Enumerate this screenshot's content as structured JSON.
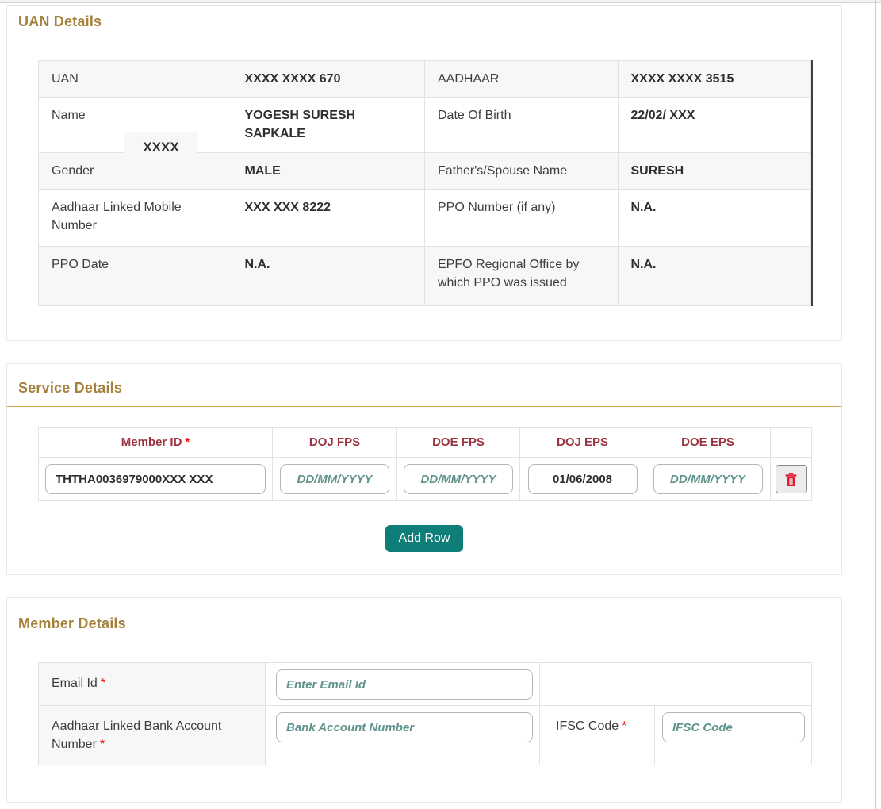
{
  "theme": {
    "heading_gold": "#a4813d",
    "rule_gold": "#d2a049",
    "maroon": "#9b3340",
    "asterisk_red": "#f40b00",
    "teal_placeholder": "#5f938b",
    "teal_button": "#0f7d78",
    "trash_red": "#e8192c",
    "label_color": "#3d3d3d",
    "value_color": "#2e2e2e",
    "stripe": "#f7f7f7",
    "border_light": "#e2e2e2",
    "dark_edge": "#3f3f3f"
  },
  "uan": {
    "title": "UAN Details",
    "overlay_text": "XXXX",
    "rows": [
      {
        "l1": "UAN",
        "v1": "XXXX XXXX 670",
        "l2": "AADHAAR",
        "v2": "XXXX XXXX 3515"
      },
      {
        "l1": "Name",
        "v1": "YOGESH SURESH SAPKALE",
        "l2": "Date Of Birth",
        "v2": "22/02/ XXX"
      },
      {
        "l1": "Gender",
        "v1": "MALE",
        "l2": "Father's/Spouse Name",
        "v2": "SURESH"
      },
      {
        "l1": "Aadhaar Linked Mobile Number",
        "v1": "XXX XXX 8222",
        "l2": "PPO Number (if any)",
        "v2": "N.A."
      },
      {
        "l1": "PPO Date",
        "v1": "N.A.",
        "l2": "EPFO Regional Office by which PPO was issued",
        "v2": "N.A."
      }
    ]
  },
  "service": {
    "title": "Service Details",
    "headers": {
      "member_id": "Member ID",
      "member_id_required": "*",
      "doj_fps": "DOJ FPS",
      "doe_fps": "DOE FPS",
      "doj_eps": "DOJ EPS",
      "doe_eps": "DOE EPS"
    },
    "row": {
      "member_id_value": "THTHA0036979000XXX XXX",
      "doj_fps_placeholder": "DD/MM/YYYY",
      "doe_fps_placeholder": "DD/MM/YYYY",
      "doj_eps_value": "01/06/2008",
      "doe_eps_placeholder": "DD/MM/YYYY",
      "delete_icon": "trash-icon"
    },
    "add_row_label": "Add Row"
  },
  "member": {
    "title": "Member Details",
    "email_label": "Email Id",
    "email_required": "*",
    "email_placeholder": "Enter Email Id",
    "bank_label": "Aadhaar Linked Bank Account Number",
    "bank_required": "*",
    "bank_placeholder": "Bank Account Number",
    "ifsc_label": "IFSC Code",
    "ifsc_required": "*",
    "ifsc_placeholder": "IFSC Code"
  }
}
